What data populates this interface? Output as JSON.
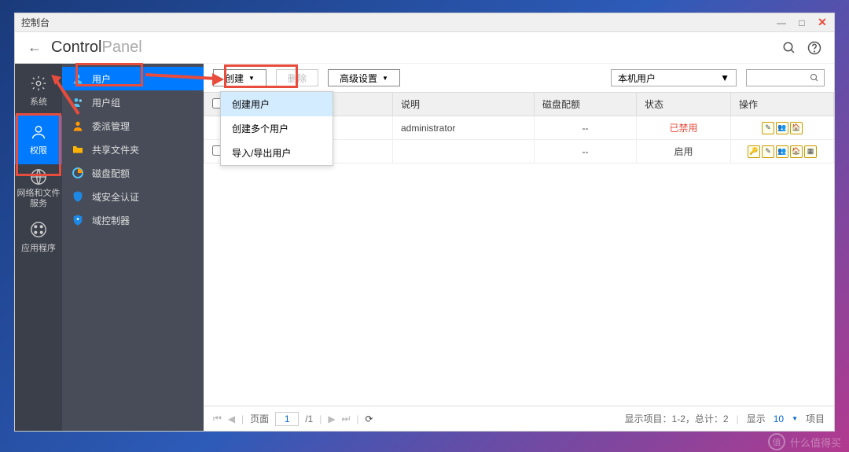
{
  "window": {
    "title": "控制台"
  },
  "header": {
    "title_bold": "Control",
    "title_light": "Panel"
  },
  "sidenav": [
    {
      "label": "系统",
      "active": false
    },
    {
      "label": "权限",
      "active": true
    },
    {
      "label": "网络和文件服务",
      "active": false
    },
    {
      "label": "应用程序",
      "active": false
    }
  ],
  "subnav": [
    {
      "label": "用户",
      "active": true
    },
    {
      "label": "用户组",
      "active": false
    },
    {
      "label": "委派管理",
      "active": false
    },
    {
      "label": "共享文件夹",
      "active": false
    },
    {
      "label": "磁盘配额",
      "active": false
    },
    {
      "label": "域安全认证",
      "active": false
    },
    {
      "label": "域控制器",
      "active": false
    }
  ],
  "toolbar": {
    "create": "创建",
    "delete": "删除",
    "advanced": "高级设置",
    "filter_select": "本机用户"
  },
  "dropdown": {
    "items": [
      "创建用户",
      "创建多个用户",
      "导入/导出用户"
    ]
  },
  "table": {
    "headers": [
      "",
      "说明",
      "磁盘配额",
      "状态",
      "操作"
    ],
    "rows": [
      {
        "desc": "administrator",
        "quota": "--",
        "status": "已禁用",
        "status_class": "status-disabled",
        "actions": 3
      },
      {
        "desc": "",
        "quota": "--",
        "status": "启用",
        "status_class": "",
        "actions": 5
      }
    ]
  },
  "pager": {
    "label_page": "页面",
    "current": "1",
    "total": "/1",
    "summary": "显示项目：1-2，总计：2",
    "show_label": "显示",
    "show_value": "10",
    "items_label": "项目"
  },
  "watermark": "什么值得买"
}
